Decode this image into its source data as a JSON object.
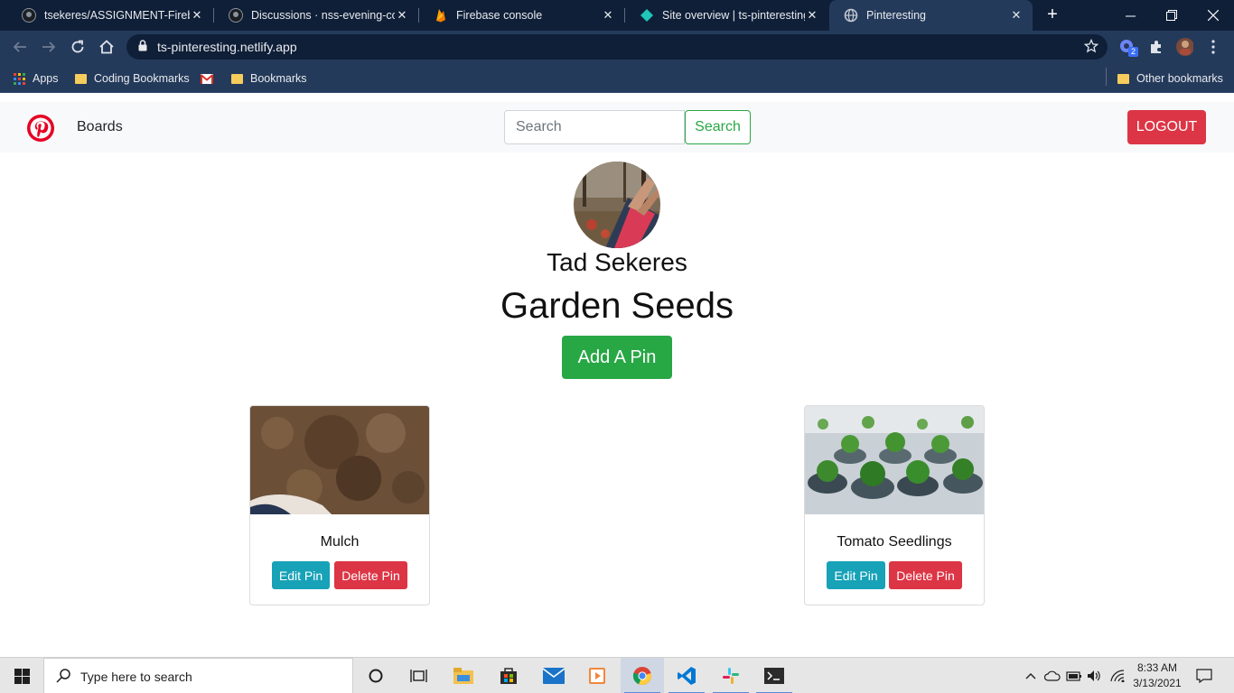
{
  "browser": {
    "tabs": [
      {
        "title": "tsekeres/ASSIGNMENT-Firebase",
        "favicon": "github-icon"
      },
      {
        "title": "Discussions · nss-evening-coho",
        "favicon": "github-icon"
      },
      {
        "title": "Firebase console",
        "favicon": "firebase-icon"
      },
      {
        "title": "Site overview | ts-pinteresting",
        "favicon": "netlify-icon"
      },
      {
        "title": "Pinteresting",
        "favicon": "globe-icon",
        "active": true
      }
    ],
    "url": "ts-pinteresting.netlify.app",
    "extension_badge": "2",
    "bookmarks": {
      "apps": "Apps",
      "coding": "Coding Bookmarks",
      "bookmarks": "Bookmarks",
      "other": "Other bookmarks"
    }
  },
  "navbar": {
    "boards_label": "Boards",
    "search_placeholder": "Search",
    "search_button": "Search",
    "logout_button": "LOGOUT"
  },
  "profile": {
    "user_name": "Tad Sekeres",
    "board_title": "Garden Seeds",
    "add_pin_button": "Add A Pin"
  },
  "pins": [
    {
      "title": "Mulch",
      "edit_label": "Edit Pin",
      "delete_label": "Delete Pin"
    },
    {
      "title": "Tomato Seedlings",
      "edit_label": "Edit Pin",
      "delete_label": "Delete Pin"
    }
  ],
  "taskbar": {
    "search_placeholder": "Type here to search",
    "time": "8:33 AM",
    "date": "3/13/2021"
  },
  "colors": {
    "tabstrip": "#0f1f38",
    "toolbar": "#243a5b",
    "success": "#28a745",
    "danger": "#dc3545",
    "info": "#17a2b8",
    "navbar_bg": "#f8f9fa"
  }
}
